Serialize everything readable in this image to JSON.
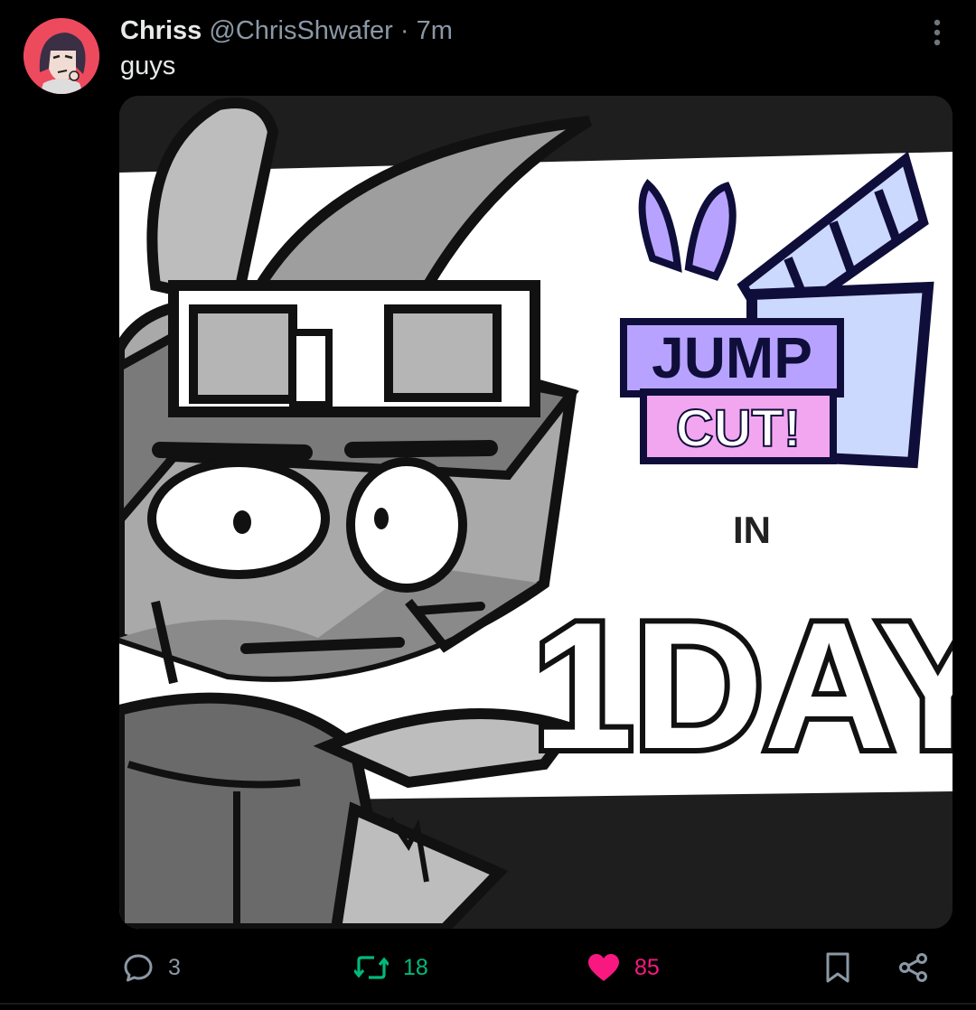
{
  "post": {
    "author_name": "Chriss",
    "author_handle": "@ChrisShwafer",
    "separator": "·",
    "time_ago": "7m",
    "text": "guys",
    "image_text": {
      "logo_line1": "JUMP",
      "logo_line2": "CUT!",
      "middle": "IN",
      "bottom": "1DAY"
    }
  },
  "actions": {
    "replies": "3",
    "retweets": "18",
    "likes": "85"
  },
  "icons": {
    "reply": "speech-bubble-icon",
    "retweet": "retweet-icon",
    "like": "heart-icon",
    "bookmark": "bookmark-icon",
    "share": "share-icon",
    "more": "vertical-dots-icon"
  },
  "colors": {
    "background": "#000000",
    "avatar_bg": "#ee4a5e",
    "retweet_green": "#00ba7c",
    "like_pink": "#f91880",
    "muted_text": "#8b98a5",
    "logo_purple": "#b7a3ff",
    "logo_pink": "#f3a6f0",
    "clapper_blue": "#ccd9ff"
  }
}
